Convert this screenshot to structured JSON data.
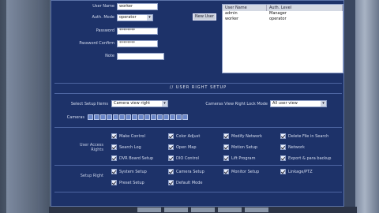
{
  "user_form": {
    "user_name_label": "User Name",
    "user_name_value": "worker",
    "auth_mode_label": "Auth. Mode",
    "auth_mode_value": "operator",
    "password_label": "Password",
    "password_value": "********",
    "password_confirm_label": "Password Confirm",
    "password_confirm_value": "********",
    "note_label": "Note",
    "note_value": "",
    "new_user_button": "New User"
  },
  "user_table": {
    "headers": [
      "User Name",
      "Auth. Level"
    ],
    "rows": [
      [
        "admin",
        "Manager"
      ],
      [
        "worker",
        "operator"
      ]
    ]
  },
  "user_right_setup": {
    "title": "USER RIGHT SETUP",
    "select_setup_items_label": "Select Setup Items",
    "select_setup_items_value": "Camera view right",
    "camera_lock_mode_label": "Cameras View Right Lock Mode",
    "camera_lock_mode_value": "All user view",
    "cameras_label": "Cameras"
  },
  "user_access_rights": {
    "group_label": "User Access Rights",
    "items": [
      "Make Control",
      "Color Adjust",
      "Modify Network",
      "Delete File in Search",
      "Search Log",
      "Open Map",
      "Motion Setup",
      "Network",
      "DVR Board Setup",
      "DIO Control",
      "Lift Program",
      "Export & para backup"
    ]
  },
  "setup_rights": {
    "group_label": "Setup Right",
    "items": [
      "System Setup",
      "Camera Setup",
      "Monitor Setup",
      "Linkage/PTZ",
      "Preset Setup",
      "Default Mode"
    ]
  }
}
